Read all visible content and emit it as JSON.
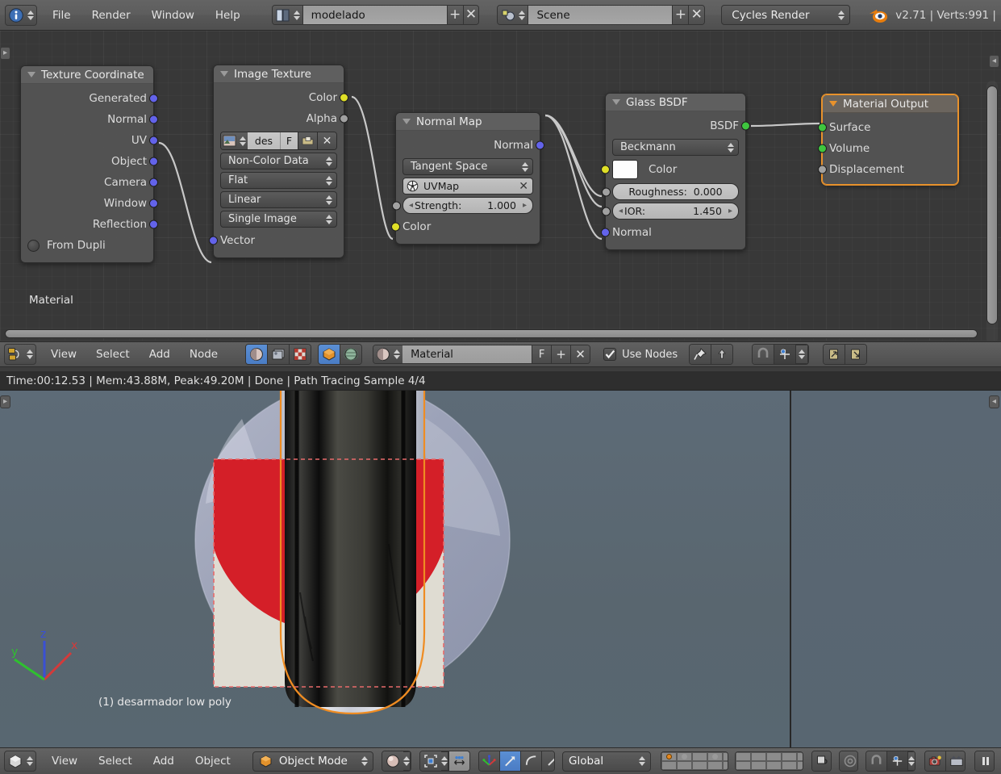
{
  "app": {
    "version_text": "v2.71 | Verts:991 |"
  },
  "topbar": {
    "editor_icon": "info-editor-icon",
    "menus": [
      "File",
      "Render",
      "Window",
      "Help"
    ],
    "screen": {
      "icon": "screen-layout-icon",
      "name": "modelado",
      "add_label": "+",
      "remove_label": "✕"
    },
    "scene": {
      "icon": "scene-icon",
      "name": "Scene",
      "add_label": "+",
      "remove_label": "✕"
    },
    "engine": {
      "label": "Cycles Render"
    },
    "blender_logo": "blender-logo-icon"
  },
  "node_editor": {
    "breadcrumb_label": "Material",
    "nodes": [
      {
        "id": "texture-coordinate",
        "title": "Texture Coordinate",
        "outputs": [
          "Generated",
          "Normal",
          "UV",
          "Object",
          "Camera",
          "Window",
          "Reflection"
        ],
        "toggle_label": "From Dupli"
      },
      {
        "id": "image-texture",
        "title": "Image Texture",
        "outputs": [
          "Color",
          "Alpha"
        ],
        "image_name": "des",
        "fake_user_label": "F",
        "open_label": "open-image-icon",
        "unlink_label": "✕",
        "colorspace": "Non-Color Data",
        "projection": "Flat",
        "interpolation": "Linear",
        "source": "Single Image",
        "inputs": [
          "Vector"
        ]
      },
      {
        "id": "normal-map",
        "title": "Normal Map",
        "outputs": [
          "Normal"
        ],
        "space": "Tangent Space",
        "uv_map": "UVMap",
        "uv_clear_label": "✕",
        "strength_label": "Strength:",
        "strength_value": "1.000",
        "inputs": [
          "Color"
        ]
      },
      {
        "id": "glass-bsdf",
        "title": "Glass BSDF",
        "outputs": [
          "BSDF"
        ],
        "distribution": "Beckmann",
        "color_label": "Color",
        "color_value": "#fdfdfd",
        "roughness_label": "Roughness:",
        "roughness_value": "0.000",
        "ior_label": "IOR:",
        "ior_value": "1.450",
        "normal_label": "Normal"
      },
      {
        "id": "material-output",
        "title": "Material Output",
        "inputs": [
          "Surface",
          "Volume",
          "Displacement"
        ],
        "selected": true
      }
    ]
  },
  "node_header": {
    "editor_icon": "node-editor-icon",
    "menus": [
      "View",
      "Select",
      "Add",
      "Node"
    ],
    "shader_type_buttons": [
      "object-shader-icon",
      "world-texture-icon",
      "checker-texture-icon"
    ],
    "context_buttons": [
      "object-cube-icon",
      "world-globe-icon"
    ],
    "slot_icon": "material-sphere-icon",
    "material_name": "Material",
    "fake_user_label": "F",
    "add_label": "+",
    "remove_label": "✕",
    "use_nodes_label": "Use Nodes",
    "use_nodes_checked": true,
    "pin_icon": "pin-icon",
    "go_parent_icon": "go-to-parent-icon",
    "snap_magnet_icon": "snap-magnet-icon",
    "snap_element_icon": "snap-vertex-icon",
    "copy_icon": "copy-to-clipboard-icon",
    "paste_icon": "paste-from-clipboard-icon"
  },
  "render_info": {
    "text": "Time:00:12.53 | Mem:43.88M, Peak:49.20M | Done | Path Tracing Sample 4/4"
  },
  "viewport": {
    "object_label": "(1) desarmador low poly",
    "axes": {
      "x": "x",
      "y": "y",
      "z": "z"
    },
    "axis_colors": {
      "x": "#d43a3a",
      "y": "#2fc02f",
      "z": "#3a50d4"
    },
    "background_color": "#5a6772",
    "outline_color": "#ef8c22",
    "render_border_color": "#e86a6a"
  },
  "footer": {
    "editor_icon": "3d-view-editor-icon",
    "menus": [
      "View",
      "Select",
      "Add",
      "Object"
    ],
    "mode": {
      "icon": "object-mode-cube-icon",
      "label": "Object Mode"
    },
    "shading_icon": "rendered-shading-icon",
    "pivot_icon": "pivot-median-point-icon",
    "manipulator_toggle_icon": "manipulator-toggle-icon",
    "manipulator_icons": [
      "translate-manipulator-icon",
      "rotate-manipulator-icon",
      "scale-manipulator-icon"
    ],
    "orientation": "Global",
    "layers": {
      "active_layer_index": 0,
      "occupied_layers": [
        0,
        1,
        3
      ]
    },
    "render_shading_icons": [
      "local-view-icon",
      "proportional-edit-icon",
      "snap-magnet-icon",
      "snap-vertex-icon"
    ],
    "render_icons": [
      "render-camera-icon",
      "render-animation-icon"
    ],
    "pause_icon": "pause-icon"
  }
}
